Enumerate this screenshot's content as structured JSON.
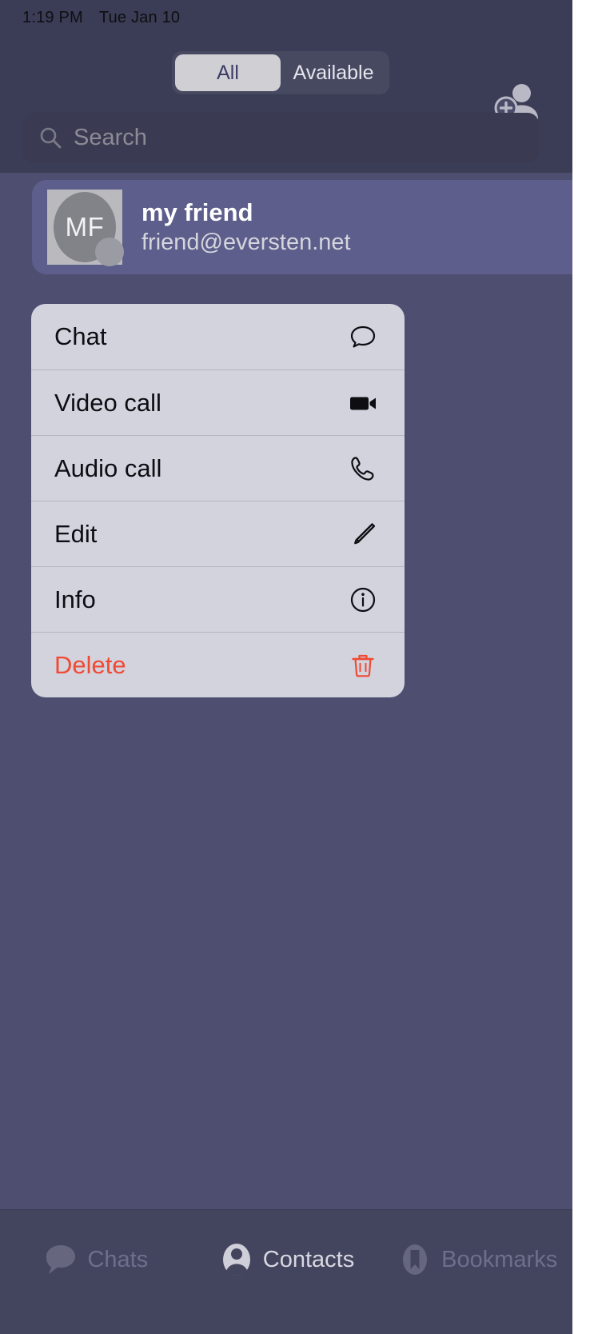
{
  "status_bar": {
    "time": "1:19 PM",
    "date": "Tue Jan 10"
  },
  "header": {
    "segmented": {
      "options": [
        {
          "label": "All",
          "selected": true
        },
        {
          "label": "Available",
          "selected": false
        }
      ]
    },
    "add_contact_icon": "add-person-icon",
    "search": {
      "placeholder": "Search",
      "value": "",
      "icon": "search-icon"
    }
  },
  "contact": {
    "initials": "MF",
    "name": "my friend",
    "email": "friend@eversten.net",
    "selected": true
  },
  "context_menu": {
    "items": [
      {
        "label": "Chat",
        "icon": "chat-bubble-icon",
        "destructive": false
      },
      {
        "label": "Video call",
        "icon": "video-camera-icon",
        "destructive": false
      },
      {
        "label": "Audio call",
        "icon": "phone-icon",
        "destructive": false
      },
      {
        "label": "Edit",
        "icon": "pencil-icon",
        "destructive": false
      },
      {
        "label": "Info",
        "icon": "info-circle-icon",
        "destructive": false
      },
      {
        "label": "Delete",
        "icon": "trash-icon",
        "destructive": true
      }
    ]
  },
  "tab_bar": {
    "tabs": [
      {
        "label": "Chats",
        "icon": "chat-bubble-icon",
        "active": false
      },
      {
        "label": "Contacts",
        "icon": "person-icon",
        "active": true
      },
      {
        "label": "Bookmarks",
        "icon": "bookmark-icon",
        "active": false
      }
    ]
  },
  "colors": {
    "app_background": "#4e4f70",
    "header_background": "#3b3c55",
    "selected_row": "#5d5e8b",
    "menu_background": "#d3d3de",
    "destructive": "#f04a34",
    "segment_active_bg": "#cfcfd4",
    "segment_active_text": "#3b3c66",
    "tab_bar_background": "#43445e"
  }
}
